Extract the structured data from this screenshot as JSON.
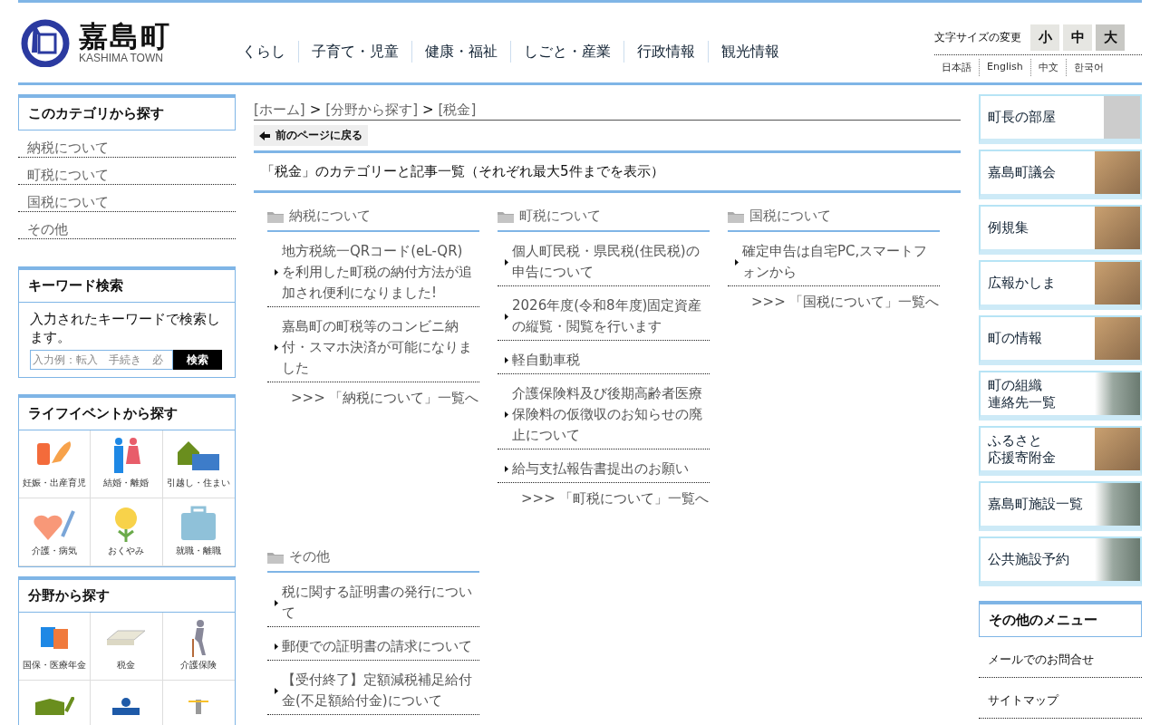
{
  "header": {
    "logo_title": "嘉島町",
    "logo_subtitle": "KASHIMA TOWN",
    "nav": [
      "くらし",
      "子育て・児童",
      "健康・福祉",
      "しごと・産業",
      "行政情報",
      "観光情報"
    ],
    "font_size_label": "文字サイズの変更",
    "font_sizes": [
      {
        "label": "小",
        "selected": false
      },
      {
        "label": "中",
        "selected": false
      },
      {
        "label": "大",
        "selected": true
      }
    ],
    "languages": [
      "日本語",
      "English",
      "中文",
      "한국어"
    ]
  },
  "left": {
    "category_title": "このカテゴリから探す",
    "categories": [
      "納税について",
      "町税について",
      "国税について",
      "その他"
    ],
    "search": {
      "title": "キーワード検索",
      "description": "入力されたキーワードで検索します。",
      "placeholder": "入力例：転入　手続き　必",
      "button": "検索"
    },
    "life_title": "ライフイベントから探す",
    "life_events": [
      {
        "kind": "bottle",
        "label": "妊娠・出産育児"
      },
      {
        "kind": "couple",
        "label": "結婚・離婚"
      },
      {
        "kind": "house",
        "label": "引越し・住まい"
      },
      {
        "kind": "heart",
        "label": "介護・病気"
      },
      {
        "kind": "flower",
        "label": "おくやみ"
      },
      {
        "kind": "briefcase",
        "label": "就職・離職"
      }
    ],
    "field_title": "分野から探す",
    "fields": [
      {
        "kind": "notebooks",
        "label": "国保・医療年金"
      },
      {
        "kind": "money",
        "label": "税金"
      },
      {
        "kind": "elder",
        "label": "介護保険"
      },
      {
        "kind": "book"
      },
      {
        "kind": "desk"
      },
      {
        "kind": "speaker"
      }
    ]
  },
  "main": {
    "breadcrumb": [
      {
        "label": "[ホーム]"
      },
      {
        "separator": ">",
        "label": "[分野から探す]"
      },
      {
        "separator": ">",
        "label": "[税金]"
      }
    ],
    "back_button": "前のページに戻る",
    "heading": "「税金」のカテゴリーと記事一覧（それぞれ最大5件までを表示）",
    "sections": [
      {
        "title": "納税について",
        "items": [
          "地方税統一QRコード(eL-QR)を利用した町税の納付方法が追加され便利になりました!",
          "嘉島町の町税等のコンビニ納付・スマホ決済が可能になりました"
        ],
        "more": ">>> 「納税について」一覧へ"
      },
      {
        "title": "町税について",
        "items": [
          "個人町民税・県民税(住民税)の申告について",
          "2026年度(令和8年度)固定資産の縦覧・閲覧を行います",
          "軽自動車税",
          "介護保険料及び後期高齢者医療保険料の仮徴収のお知らせの廃止について",
          "給与支払報告書提出のお願い"
        ],
        "more": ">>> 「町税について」一覧へ"
      },
      {
        "title": "国税について",
        "items": [
          "確定申告は自宅PC,スマートフォンから"
        ],
        "more": ">>> 「国税について」一覧へ"
      },
      {
        "title": "その他",
        "items": [
          "税に関する証明書の発行について",
          "郵便での証明書の請求について",
          "【受付終了】定額減税補足給付金(不足額給付金)について"
        ]
      }
    ]
  },
  "right": {
    "banners": [
      {
        "label": "町長の部屋",
        "kind": "portrait"
      },
      {
        "label": "嘉島町議会",
        "kind": "photo"
      },
      {
        "label": "例規集",
        "kind": "photo"
      },
      {
        "label": "広報かしま",
        "kind": "photo"
      },
      {
        "label": "町の情報",
        "kind": "photo"
      },
      {
        "lines": [
          "町の組織",
          "連絡先一覧"
        ],
        "kind": "wide"
      },
      {
        "lines": [
          "ふるさと",
          "応援寄附金"
        ],
        "kind": "photo"
      },
      {
        "label": "嘉島町施設一覧",
        "kind": "wide"
      },
      {
        "label": "公共施設予約",
        "kind": "wide"
      }
    ],
    "menu_title": "その他のメニュー",
    "menu": [
      "メールでのお問合せ",
      "サイトマップ"
    ]
  }
}
